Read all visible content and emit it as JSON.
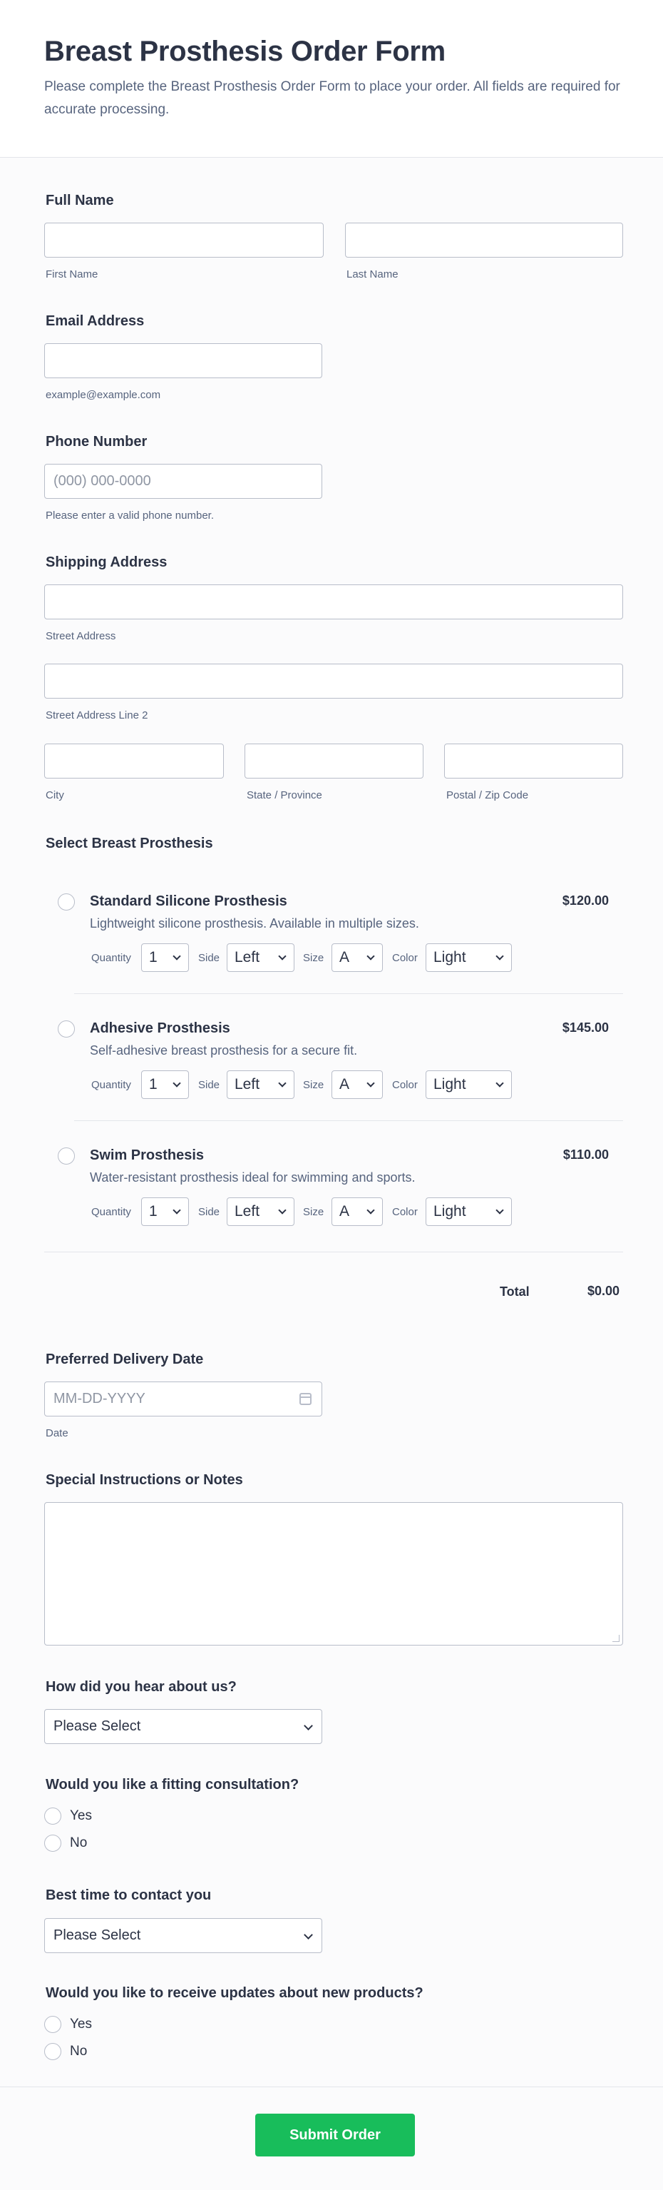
{
  "header": {
    "title": "Breast Prosthesis Order Form",
    "description": "Please complete the Breast Prosthesis Order Form to place your order. All fields are required for accurate processing."
  },
  "full_name": {
    "label": "Full Name",
    "first_sublabel": "First Name",
    "last_sublabel": "Last Name",
    "first_value": "",
    "last_value": ""
  },
  "email": {
    "label": "Email Address",
    "sublabel": "example@example.com",
    "value": ""
  },
  "phone": {
    "label": "Phone Number",
    "placeholder": "(000) 000-0000",
    "sublabel": "Please enter a valid phone number."
  },
  "address": {
    "label": "Shipping Address",
    "street_sublabel": "Street Address",
    "street2_sublabel": "Street Address Line 2",
    "city_sublabel": "City",
    "state_sublabel": "State / Province",
    "postal_sublabel": "Postal / Zip Code"
  },
  "products": {
    "label": "Select Breast Prosthesis",
    "option_labels": {
      "quantity": "Quantity",
      "side": "Side",
      "size": "Size",
      "color": "Color"
    },
    "items": [
      {
        "name": "Standard Silicone Prosthesis",
        "description": "Lightweight silicone prosthesis. Available in multiple sizes.",
        "price": "$120.00",
        "quantity": "1",
        "side": "Left",
        "size": "A",
        "color": "Light"
      },
      {
        "name": "Adhesive Prosthesis",
        "description": "Self-adhesive breast prosthesis for a secure fit.",
        "price": "$145.00",
        "quantity": "1",
        "side": "Left",
        "size": "A",
        "color": "Light"
      },
      {
        "name": "Swim Prosthesis",
        "description": "Water-resistant prosthesis ideal for swimming and sports.",
        "price": "$110.00",
        "quantity": "1",
        "side": "Left",
        "size": "A",
        "color": "Light"
      }
    ],
    "total_label": "Total",
    "total_value": "$0.00"
  },
  "delivery": {
    "label": "Preferred Delivery Date",
    "placeholder": "MM-DD-YYYY",
    "sublabel": "Date",
    "icon": "calendar-icon"
  },
  "notes": {
    "label": "Special Instructions or Notes",
    "value": ""
  },
  "referral": {
    "label": "How did you hear about us?",
    "selected": "Please Select"
  },
  "consultation": {
    "label": "Would you like a fitting consultation?",
    "options": [
      "Yes",
      "No"
    ]
  },
  "contact_time": {
    "label": "Best time to contact you",
    "selected": "Please Select"
  },
  "updates": {
    "label": "Would you like to receive updates about new products?",
    "options": [
      "Yes",
      "No"
    ]
  },
  "submit": {
    "label": "Submit Order"
  },
  "colors": {
    "accent": "#18bd5b",
    "text": "#2c3345",
    "muted": "#57647e",
    "border": "#b8bdc9"
  }
}
